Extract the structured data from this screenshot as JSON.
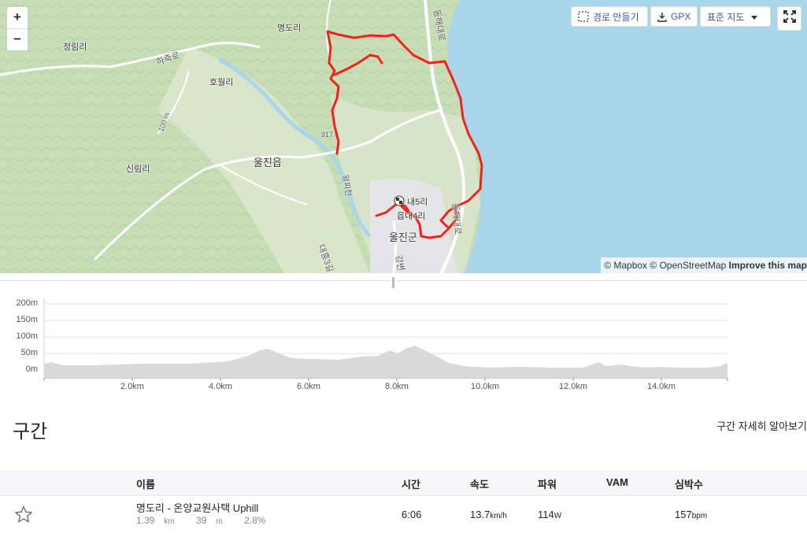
{
  "map": {
    "labels": {
      "myeongdori": "명도리",
      "jeongrimri": "정림리",
      "hajukro": "하죽로",
      "howolri": "호월리",
      "uljineup": "울진읍",
      "sinrimri": "신림리",
      "nae5ri": "내5리",
      "eup4ri": "읍내4리",
      "uljingun": "울진군",
      "donghaedaero_n": "동해대로",
      "donghaedaero_s": "동해대로",
      "road917": "917",
      "road100m": "100 m",
      "valley": "왕피천",
      "gang": "강변",
      "bottom": "대흥3길"
    },
    "zoom_in": "+",
    "zoom_out": "−",
    "buttons": {
      "route": "경로 만들기",
      "gpx": "GPX",
      "style": "표준 지도"
    },
    "attribution": {
      "mapbox": "© Mapbox",
      "osm": "© OpenStreetMap",
      "improve": "Improve this map"
    },
    "colors": {
      "route": "#f2221a",
      "sea": "#a9d6ea",
      "land": "#cfe3bf"
    }
  },
  "elevation": {
    "y_labels": [
      "200m",
      "150m",
      "100m",
      "50m",
      "0m"
    ],
    "x_labels": [
      "2.0km",
      "4.0km",
      "6.0km",
      "8.0km",
      "10.0km",
      "12.0km",
      "14.0km"
    ]
  },
  "segments": {
    "title": "구간",
    "more_link": "구간 자세히 알아보기",
    "headers": {
      "name": "이름",
      "time": "시간",
      "speed": "속도",
      "power": "파워",
      "vam": "VAM",
      "heartrate": "심박수"
    },
    "rows": [
      {
        "name": "명도리 - 온양교원사택 Uphill",
        "distance": "1.39",
        "distance_unit": "km",
        "elev": "39",
        "elev_unit": "m",
        "grade": "2.8%",
        "time": "6:06",
        "speed": "13.7",
        "speed_unit": "km/h",
        "power": "114",
        "power_unit": "W",
        "vam": "",
        "heartrate": "157",
        "heartrate_unit": "bpm"
      }
    ]
  }
}
